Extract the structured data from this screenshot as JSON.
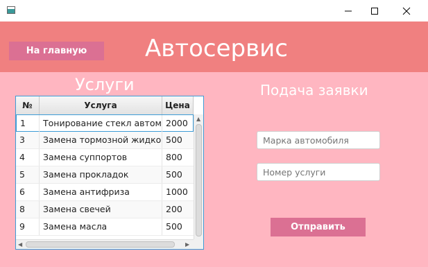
{
  "window": {
    "controls": [
      "minimize-icon",
      "maximize-icon",
      "close-icon"
    ]
  },
  "header": {
    "home_button": "На главную",
    "title": "Автосервис"
  },
  "services": {
    "title": "Услуги",
    "columns": [
      "№",
      "Услуга",
      "Цена"
    ],
    "rows": [
      {
        "num": "1",
        "service": "Тонирование стекл автомобиля",
        "price": "2000"
      },
      {
        "num": "3",
        "service": "Замена тормозной жидкости",
        "price": "500"
      },
      {
        "num": "4",
        "service": "Замена суппортов",
        "price": "800"
      },
      {
        "num": "5",
        "service": "Замена прокладок",
        "price": "500"
      },
      {
        "num": "6",
        "service": "Замена антифриза",
        "price": "1000"
      },
      {
        "num": "8",
        "service": "Замена свечей",
        "price": "200"
      },
      {
        "num": "9",
        "service": "Замена масла",
        "price": "500"
      }
    ]
  },
  "request": {
    "title": "Подача заявки",
    "car_brand_placeholder": "Марка автомобиля",
    "service_number_placeholder": "Номер услуги",
    "submit_button": "Отправить"
  },
  "colors": {
    "background": "#ffb6c1",
    "header": "#f08080",
    "button": "#db7093",
    "selection_border": "#3c9bd6"
  }
}
